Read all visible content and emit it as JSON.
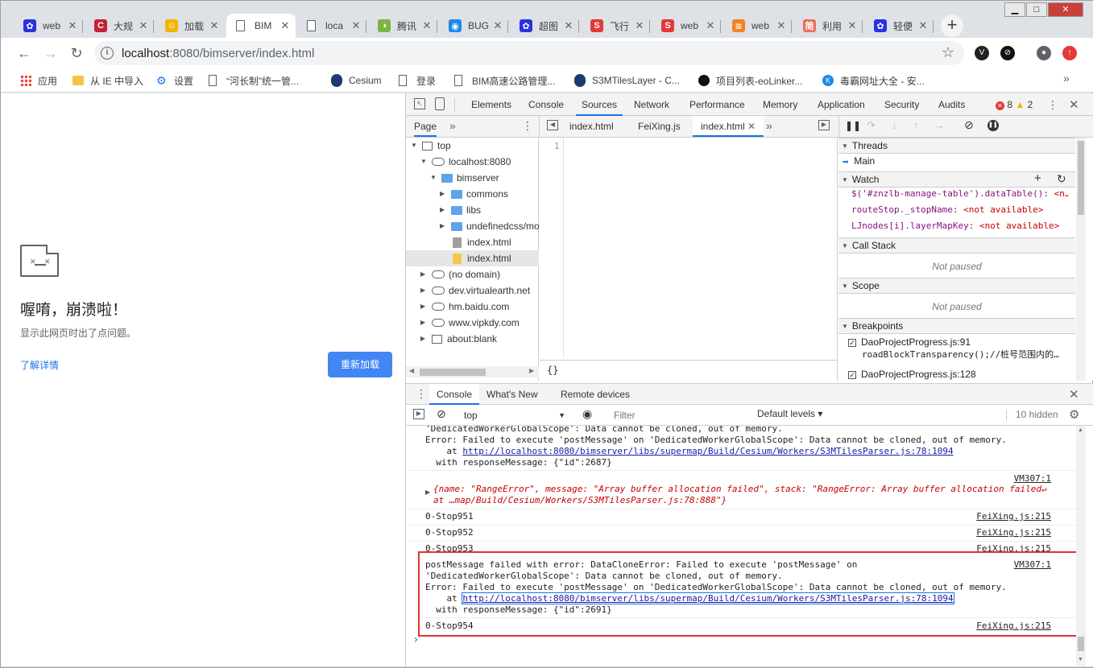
{
  "tabs": [
    {
      "label": "web",
      "icon": "paw-icon",
      "color": "#2932e1",
      "glyph": "✿"
    },
    {
      "label": "大规",
      "icon": "csdn-icon",
      "color": "#c32136",
      "glyph": "C"
    },
    {
      "label": "加载",
      "icon": "juejin-icon",
      "color": "#f4b400",
      "glyph": "☺"
    },
    {
      "label": "BIM",
      "icon": "page-icon",
      "color": "#ffffff",
      "glyph": ""
    },
    {
      "label": "loca",
      "icon": "page-icon",
      "color": "#ffffff",
      "glyph": ""
    },
    {
      "label": "腾讯",
      "icon": "tencent-icon",
      "color": "#7cb342",
      "glyph": "◑"
    },
    {
      "label": "BUG",
      "icon": "globe-icon",
      "color": "#1e88e5",
      "glyph": "◉"
    },
    {
      "label": "超图",
      "icon": "paw-icon",
      "color": "#2932e1",
      "glyph": "✿"
    },
    {
      "label": "飞行",
      "icon": "s-icon",
      "color": "#e53935",
      "glyph": "S"
    },
    {
      "label": "web",
      "icon": "s-icon",
      "color": "#e53935",
      "glyph": "S"
    },
    {
      "label": "web",
      "icon": "stack-icon",
      "color": "#f48024",
      "glyph": "≋"
    },
    {
      "label": "利用",
      "icon": "jian-icon",
      "color": "#ea6f5a",
      "glyph": "简"
    },
    {
      "label": "轻便",
      "icon": "paw-icon",
      "color": "#2932e1",
      "glyph": "✿"
    }
  ],
  "url": {
    "host": "localhost",
    "rest": ":8080/bimserver/index.html"
  },
  "bookmarks": [
    {
      "label": "应用",
      "icon": "apps-grid-icon"
    },
    {
      "label": "从 IE 中导入",
      "icon": "folder-icon"
    },
    {
      "label": "设置",
      "icon": "gear-icon"
    },
    {
      "label": "“河长制”统一管...",
      "icon": "page-icon"
    },
    {
      "label": "Cesium",
      "icon": "cesium-icon"
    },
    {
      "label": "登录",
      "icon": "page-icon"
    },
    {
      "label": "BIM高速公路管理...",
      "icon": "page-icon"
    },
    {
      "label": "S3MTilesLayer - C...",
      "icon": "cesium-icon"
    },
    {
      "label": "项目列表-eoLinker...",
      "icon": "eolinker-icon"
    },
    {
      "label": "毒霸网址大全 - 安...",
      "icon": "k-icon"
    }
  ],
  "crash": {
    "title": "喔唷，崩溃啦！",
    "subtitle": "显示此网页时出了点问题。",
    "learn": "了解详情",
    "reload": "重新加载"
  },
  "devtools": {
    "tabs": [
      "Elements",
      "Console",
      "Sources",
      "Network",
      "Performance",
      "Memory",
      "Application",
      "Security",
      "Audits"
    ],
    "errors": "8",
    "warnings": "2",
    "page_tab": "Page",
    "files": [
      "index.html",
      "FeiXing.js",
      "index.html"
    ],
    "tree": [
      {
        "label": "top",
        "depth": 0,
        "arrow": "▼",
        "kind": "box"
      },
      {
        "label": "localhost:8080",
        "depth": 1,
        "arrow": "▼",
        "kind": "cloud"
      },
      {
        "label": "bimserver",
        "depth": 2,
        "arrow": "▼",
        "kind": "folder"
      },
      {
        "label": "commons",
        "depth": 3,
        "arrow": "▶",
        "kind": "folder"
      },
      {
        "label": "libs",
        "depth": 3,
        "arrow": "▶",
        "kind": "folder"
      },
      {
        "label": "undefinedcss/mo",
        "depth": 3,
        "arrow": "▶",
        "kind": "folder"
      },
      {
        "label": "index.html",
        "depth": 3,
        "arrow": "",
        "kind": "file"
      },
      {
        "label": "index.html",
        "depth": 3,
        "arrow": "",
        "kind": "filey"
      },
      {
        "label": "(no domain)",
        "depth": 1,
        "arrow": "▶",
        "kind": "cloud"
      },
      {
        "label": "dev.virtualearth.net",
        "depth": 1,
        "arrow": "▶",
        "kind": "cloud"
      },
      {
        "label": "hm.baidu.com",
        "depth": 1,
        "arrow": "▶",
        "kind": "cloud"
      },
      {
        "label": "www.vipkdy.com",
        "depth": 1,
        "arrow": "▶",
        "kind": "cloud"
      },
      {
        "label": "about:blank",
        "depth": 1,
        "arrow": "▶",
        "kind": "box"
      }
    ],
    "line_no": "1",
    "braces": "{}",
    "sections": {
      "threads": "Threads",
      "main": "Main",
      "watch": "Watch",
      "callstack": "Call Stack",
      "scope": "Scope",
      "breakpoints": "Breakpoints",
      "not_paused": "Not paused"
    },
    "watch": [
      {
        "k": "$('#znzlb-manage-table').dataTable():",
        "v": " <n…"
      },
      {
        "k": "routeStop._stopName:",
        "v": " <not available>"
      },
      {
        "k": "LJnodes[i].layerMapKey:",
        "v": " <not available>"
      }
    ],
    "breakpoints": [
      {
        "file": "DaoProjectProgress.js:91",
        "code": "roadBlockTransparency();//桩号范围内的…"
      },
      {
        "file": "DaoProjectProgress.js:128",
        "code": ""
      }
    ],
    "drawer_tabs": [
      "Console",
      "What's New",
      "Remote devices"
    ],
    "context": "top",
    "filter_placeholder": "Filter",
    "levels": "Default levels ▾",
    "hidden": "10 hidden",
    "log": {
      "a1": "'DedicatedWorkerGlobalScope': Data cannot be cloned, out of memory.",
      "a2": "Error: Failed to execute 'postMessage' on 'DedicatedWorkerGlobalScope': Data cannot be cloned, out of memory.",
      "a3pre": "    at ",
      "a3link": "http://localhost:8080/bimserver/libs/supermap/Build/Cesium/Workers/S3MTilesParser.js:78:1094",
      "a4": "  with responseMessage: {\"id\":2687}",
      "vm": "VM307:1",
      "obj1": "{name: \"RangeError\", message: \"Array buffer allocation failed\", stack: \"RangeError: Array buffer allocation failed↵",
      "obj2": "at …map/Build/Cesium/Workers/S3MTilesParser.js:78:888\"}",
      "s951": "0-Stop951",
      "s952": "0-Stop952",
      "s953": "0-Stop953",
      "s954": "0-Stop954",
      "fx": "FeiXing.js:215",
      "b1": "postMessage failed with error: DataCloneError: Failed to execute 'postMessage' on",
      "b2": "'DedicatedWorkerGlobalScope': Data cannot be cloned, out of memory.",
      "b3": "Error: Failed to execute 'postMessage' on 'DedicatedWorkerGlobalScope': Data cannot be cloned, out of memory.",
      "b5": "  with responseMessage: {\"id\":2691}",
      "prompt": "›"
    }
  }
}
